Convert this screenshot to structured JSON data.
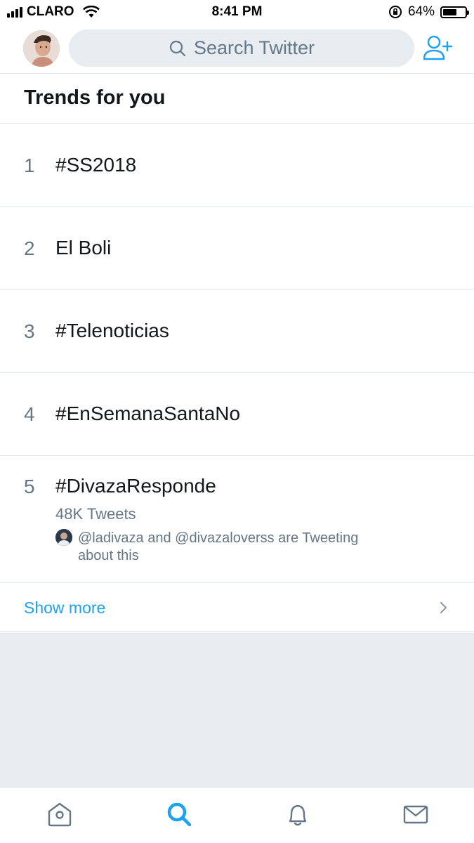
{
  "status_bar": {
    "carrier": "CLARO",
    "time": "8:41 PM",
    "battery": "64%",
    "battery_level": 0.64
  },
  "header": {
    "search_placeholder": "Search Twitter",
    "avatar_icon": "profile-avatar",
    "add_user_icon": "add-user-icon"
  },
  "trends": {
    "title": "Trends for you",
    "items": [
      {
        "rank": "1",
        "name": "#SS2018"
      },
      {
        "rank": "2",
        "name": "El Boli"
      },
      {
        "rank": "3",
        "name": "#Telenoticias"
      },
      {
        "rank": "4",
        "name": "#EnSemanaSantaNo"
      },
      {
        "rank": "5",
        "name": "#DivazaResponde",
        "count": "48K Tweets",
        "context_line1": "@ladivaza and @divazaloverss are Tweeting",
        "context_line2": "about this"
      }
    ],
    "show_more": "Show more"
  },
  "tab_bar": {
    "tabs": [
      "home-icon",
      "search-icon",
      "notifications-icon",
      "messages-icon"
    ],
    "active": "search-icon"
  },
  "colors": {
    "accent": "#1da1f2",
    "secondary_text": "#657786",
    "divider": "#e1e8ed",
    "background_gray": "#e6ecf0"
  }
}
